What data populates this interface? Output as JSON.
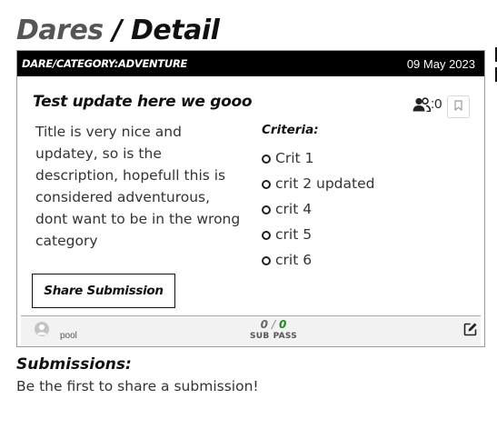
{
  "header": {
    "title_primary": "Dares",
    "title_separator": "/",
    "title_secondary": "Detail"
  },
  "dare": {
    "category": "DARE/CATEGORY:ADVENTURE",
    "date": "09 May 2023",
    "title": "Test update here we gooo",
    "participants_count": ":0",
    "description": "Title is very nice and updatey, so is the description, hopefull this is considered adventurous, dont want to be in the wrong category",
    "criteria_title": "Criteria:",
    "criteria": [
      "Crit 1",
      "crit 2 updated",
      "crit 4",
      "crit 5",
      "crit 6"
    ],
    "share_label": "Share Submission",
    "footer": {
      "username": "pool",
      "sub_count": "0",
      "separator": "/",
      "pass_count": "0",
      "sub_label": "SUB",
      "pass_label": "PASS"
    }
  },
  "submissions": {
    "title": "Submissions:",
    "empty_text": "Be the first to share a submission!"
  },
  "colors": {
    "header_bg": "#000000",
    "pass_green": "#1e8c1e",
    "title_grey": "#555555"
  },
  "icons": {
    "participants": "users-icon",
    "bookmark": "bookmark-icon",
    "avatar": "user-avatar-icon",
    "edit": "edit-icon"
  }
}
